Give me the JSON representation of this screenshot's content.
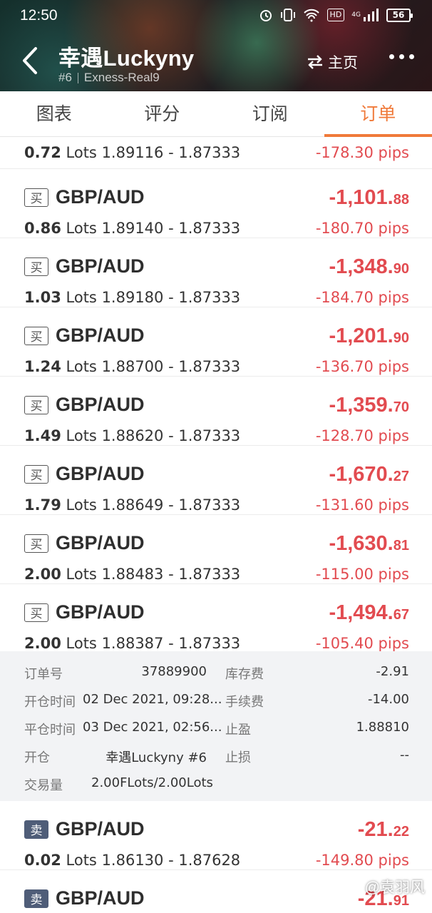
{
  "status_bar": {
    "time": "12:50",
    "hd_badge": "HD",
    "network": "4G",
    "battery": "56"
  },
  "header": {
    "title": "幸遇Luckyny",
    "rank": "#6",
    "server": "Exness-Real9",
    "home_label": "主页",
    "home_icon": "swap-arrows-icon",
    "back_icon": "chevron-left-icon",
    "more_icon": "more-dots-icon"
  },
  "tabs": [
    {
      "label": "图表",
      "active": false
    },
    {
      "label": "评分",
      "active": false
    },
    {
      "label": "订阅",
      "active": false
    },
    {
      "label": "订单",
      "active": true
    }
  ],
  "partial_order": {
    "lots": "0.72",
    "lots_unit": "Lots",
    "prices": "1.89116 - 1.87333",
    "pips": "-178.30 pips"
  },
  "orders": [
    {
      "direction": "买",
      "symbol": "GBP/AUD",
      "profit_int": "-1,101.",
      "profit_dec": "88",
      "lots": "0.86",
      "lots_unit": "Lots",
      "prices": "1.89140 - 1.87333",
      "pips": "-180.70 pips"
    },
    {
      "direction": "买",
      "symbol": "GBP/AUD",
      "profit_int": "-1,348.",
      "profit_dec": "90",
      "lots": "1.03",
      "lots_unit": "Lots",
      "prices": "1.89180 - 1.87333",
      "pips": "-184.70 pips"
    },
    {
      "direction": "买",
      "symbol": "GBP/AUD",
      "profit_int": "-1,201.",
      "profit_dec": "90",
      "lots": "1.24",
      "lots_unit": "Lots",
      "prices": "1.88700 - 1.87333",
      "pips": "-136.70 pips"
    },
    {
      "direction": "买",
      "symbol": "GBP/AUD",
      "profit_int": "-1,359.",
      "profit_dec": "70",
      "lots": "1.49",
      "lots_unit": "Lots",
      "prices": "1.88620 - 1.87333",
      "pips": "-128.70 pips"
    },
    {
      "direction": "买",
      "symbol": "GBP/AUD",
      "profit_int": "-1,670.",
      "profit_dec": "27",
      "lots": "1.79",
      "lots_unit": "Lots",
      "prices": "1.88649 - 1.87333",
      "pips": "-131.60 pips"
    },
    {
      "direction": "买",
      "symbol": "GBP/AUD",
      "profit_int": "-1,630.",
      "profit_dec": "81",
      "lots": "2.00",
      "lots_unit": "Lots",
      "prices": "1.88483 - 1.87333",
      "pips": "-115.00 pips"
    },
    {
      "direction": "买",
      "symbol": "GBP/AUD",
      "profit_int": "-1,494.",
      "profit_dec": "67",
      "lots": "2.00",
      "lots_unit": "Lots",
      "prices": "1.88387 - 1.87333",
      "pips": "-105.40 pips"
    },
    {
      "direction": "卖",
      "symbol": "GBP/AUD",
      "profit_int": "-21.",
      "profit_dec": "22",
      "lots": "0.02",
      "lots_unit": "Lots",
      "prices": "1.86130 - 1.87628",
      "pips": "-149.80 pips"
    },
    {
      "direction": "卖",
      "symbol": "GBP/AUD",
      "profit_int": "-21.",
      "profit_dec": "91",
      "lots": "",
      "lots_unit": "",
      "prices": "",
      "pips": ""
    }
  ],
  "detail": {
    "order_no_label": "订单号",
    "order_no": "37889900",
    "swap_label": "库存费",
    "swap": "-2.91",
    "open_time_label": "开仓时间",
    "open_time": "02 Dec 2021, 09:28...",
    "commission_label": "手续费",
    "commission": "-14.00",
    "close_time_label": "平仓时间",
    "close_time": "03 Dec 2021, 02:56...",
    "tp_label": "止盈",
    "tp": "1.88810",
    "open_by_label": "开仓",
    "open_by": "幸遇Luckyny  #6",
    "sl_label": "止损",
    "sl": "--",
    "volume_label": "交易量",
    "volume": "2.00FLots/2.00Lots"
  },
  "watermark": "@袁羽风",
  "colors": {
    "accent": "#f07a3a",
    "loss": "#e24b50",
    "sell_badge": "#4f5d78",
    "detail_bg": "#f2f3f5"
  }
}
